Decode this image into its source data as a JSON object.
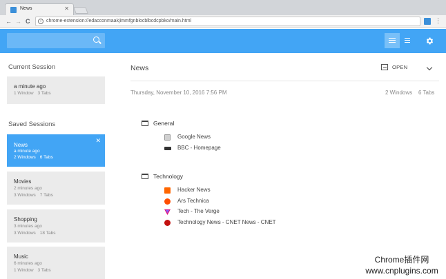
{
  "browser": {
    "tab_title": "News",
    "tab_close": "✕",
    "url": "chrome-extension://edacconmaakjimmfgnblocblbcdcpbko/main.html",
    "menu_icon": "⋮",
    "back_icon": "←",
    "forward_icon": "→",
    "reload_icon": "C"
  },
  "app": {
    "accent_color": "#42a5f5",
    "search": {
      "placeholder": ""
    },
    "icons": [
      "search-icon",
      "list-view-icon",
      "detail-view-icon",
      "gear-icon"
    ]
  },
  "sidebar": {
    "current_heading": "Current Session",
    "current": {
      "name": "a minute ago",
      "windows": "1 Window",
      "tabs": "3 Tabs"
    },
    "saved_heading": "Saved Sessions",
    "saved": [
      {
        "name": "News",
        "time": "a minute ago",
        "windows": "2 Windows",
        "tabs": "6 Tabs",
        "close": "✕"
      },
      {
        "name": "Movies",
        "time": "2 minutes ago",
        "windows": "3 Windows",
        "tabs": "7 Tabs"
      },
      {
        "name": "Shopping",
        "time": "3 minutes ago",
        "windows": "3 Windows",
        "tabs": "18 Tabs"
      },
      {
        "name": "Music",
        "time": "6 minutes ago",
        "windows": "1 Window",
        "tabs": "3 Tabs"
      }
    ]
  },
  "main": {
    "title": "News",
    "open_label": "OPEN",
    "date": "Thursday, November 10, 2016 7:56 PM",
    "windows": "2 Windows",
    "tabs": "6 Tabs",
    "groups": [
      {
        "title": "General",
        "tabs": [
          {
            "title": "Google News",
            "favicon_color": "#9e9e9e"
          },
          {
            "title": "BBC - Homepage",
            "favicon_color": "#333333"
          }
        ]
      },
      {
        "title": "Technology",
        "tabs": [
          {
            "title": "Hacker News",
            "favicon_color": "#ff6600"
          },
          {
            "title": "Ars Technica",
            "favicon_color": "#ff4e00"
          },
          {
            "title": "Tech - The Verge",
            "favicon_color": "#e5127d"
          },
          {
            "title": "Technology News - CNET News - CNET",
            "favicon_color": "#c3110f"
          }
        ]
      }
    ]
  },
  "watermark": {
    "line1": "Chrome插件网",
    "line2": "www.cnplugins.com"
  }
}
